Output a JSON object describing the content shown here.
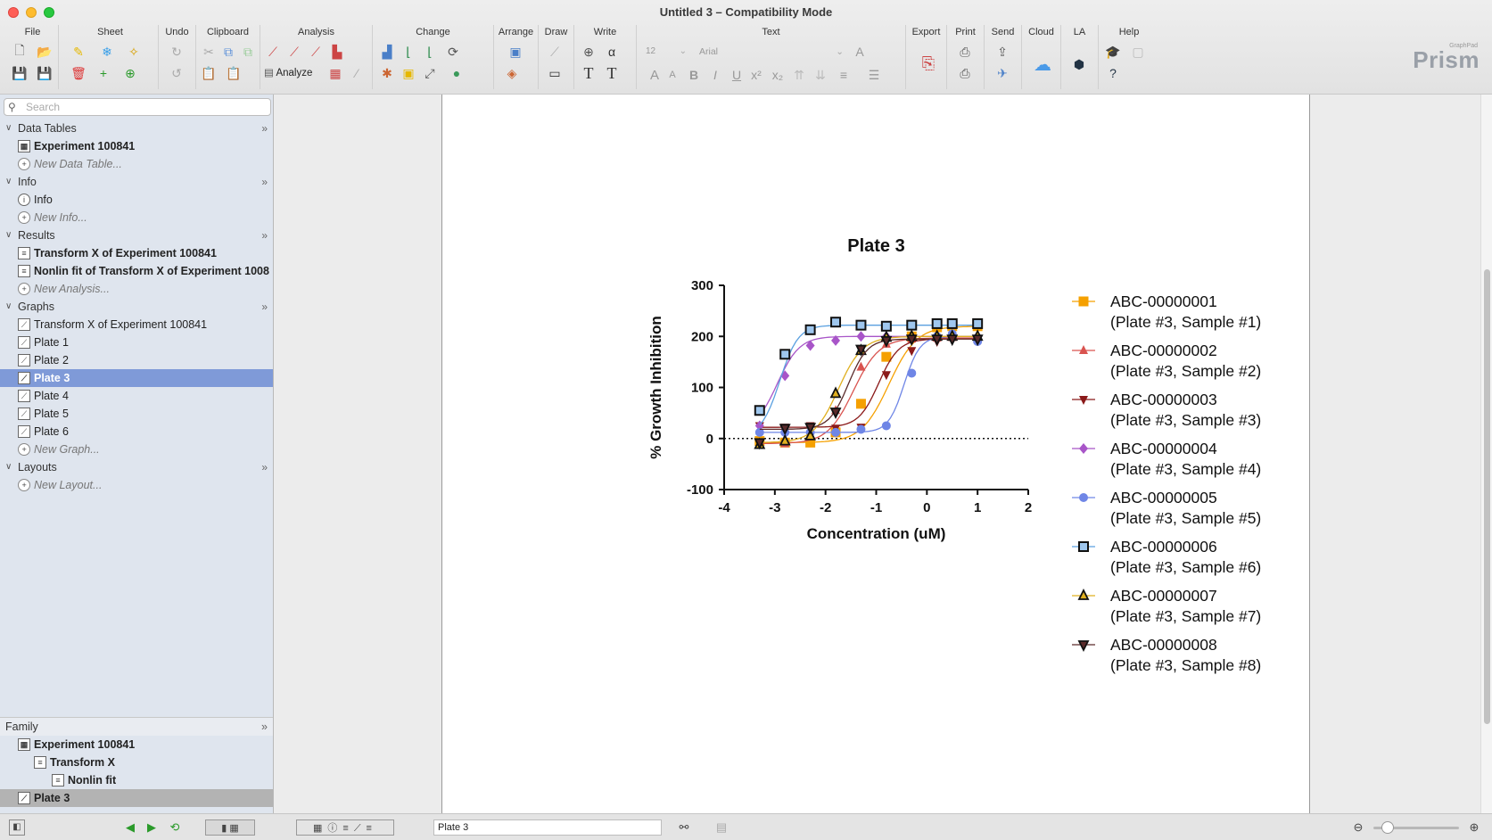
{
  "window": {
    "title": "Untitled 3 – Compatibility Mode"
  },
  "toolbar": {
    "groups": [
      "File",
      "Sheet",
      "Undo",
      "Clipboard",
      "Analysis",
      "Change",
      "Arrange",
      "Draw",
      "Write",
      "Text",
      "Export",
      "Print",
      "Send",
      "Cloud",
      "LA",
      "Help"
    ],
    "analyze_label": "Analyze",
    "font_size": "12",
    "font_name": "Arial",
    "brand_small": "GraphPad",
    "brand": "Prism"
  },
  "sidebar": {
    "search_placeholder": "Search",
    "sections": {
      "data_tables": "Data Tables",
      "info": "Info",
      "results": "Results",
      "graphs": "Graphs",
      "layouts": "Layouts"
    },
    "data_tables": [
      "Experiment 100841",
      "New Data Table..."
    ],
    "info": [
      "Info",
      "New Info..."
    ],
    "results": [
      "Transform X of Experiment 100841",
      "Nonlin fit of Transform X of Experiment 1008",
      "New Analysis..."
    ],
    "graphs": [
      "Transform X of Experiment 100841",
      "Plate 1",
      "Plate 2",
      "Plate 3",
      "Plate 4",
      "Plate 5",
      "Plate 6",
      "New Graph..."
    ],
    "layouts": [
      "New Layout..."
    ],
    "family_label": "Family",
    "family": [
      "Experiment 100841",
      "Transform X",
      "Nonlin fit",
      "Plate 3"
    ]
  },
  "status": {
    "sheet_name": "Plate 3"
  },
  "chart_data": {
    "type": "scatter",
    "title": "Plate 3",
    "xlabel": "Concentration (uM)",
    "ylabel": "% Growth Inhibition",
    "xlim": [
      -4,
      2
    ],
    "ylim": [
      -100,
      300
    ],
    "xticks": [
      -4,
      -3,
      -2,
      -1,
      0,
      1,
      2
    ],
    "yticks": [
      -100,
      0,
      100,
      200,
      300
    ],
    "zero_line": "dotted",
    "legend_position": "right",
    "x": [
      -3.3,
      -2.8,
      -2.3,
      -1.8,
      -1.3,
      -0.8,
      -0.3,
      0.2,
      0.5,
      1.0
    ],
    "series": [
      {
        "name": "ABC-00000001",
        "sub": "(Plate #3, Sample #1)",
        "color": "#f5a000",
        "marker": "square",
        "values": [
          -5,
          -8,
          -8,
          12,
          68,
          160,
          200,
          218,
          220,
          220
        ],
        "fit_ec50": -0.75,
        "top": 220,
        "bottom": -8,
        "hill": 1.6
      },
      {
        "name": "ABC-00000002",
        "sub": "(Plate #3, Sample #2)",
        "color": "#d9534f",
        "marker": "triangle-up",
        "values": [
          -10,
          -10,
          8,
          55,
          140,
          185,
          195,
          197,
          198,
          196
        ],
        "fit_ec50": -1.45,
        "top": 197,
        "bottom": -10,
        "hill": 1.7
      },
      {
        "name": "ABC-00000003",
        "sub": "(Plate #3, Sample #3)",
        "color": "#8b1a1a",
        "marker": "triangle-down",
        "values": [
          25,
          22,
          25,
          20,
          22,
          125,
          172,
          190,
          195,
          195
        ],
        "fit_ec50": -0.95,
        "top": 195,
        "bottom": 22,
        "hill": 2.2
      },
      {
        "name": "ABC-00000004",
        "sub": "(Plate #3, Sample #4)",
        "color": "#a855c8",
        "marker": "diamond",
        "values": [
          25,
          123,
          182,
          192,
          200,
          200,
          200,
          200,
          200,
          200
        ],
        "fit_ec50": -2.95,
        "top": 200,
        "bottom": 15,
        "hill": 2.0
      },
      {
        "name": "ABC-00000005",
        "sub": "(Plate #3, Sample #5)",
        "color": "#6f86e6",
        "marker": "circle",
        "values": [
          12,
          12,
          12,
          12,
          18,
          25,
          128,
          200,
          205,
          190
        ],
        "fit_ec50": -0.45,
        "top": 200,
        "bottom": 12,
        "hill": 2.8
      },
      {
        "name": "ABC-00000006",
        "sub": "(Plate #3, Sample #6)",
        "color": "#5aa0e0",
        "marker": "square-open",
        "values": [
          55,
          165,
          213,
          228,
          222,
          220,
          222,
          225,
          225,
          225
        ],
        "fit_ec50": -2.9,
        "top": 222,
        "bottom": 5,
        "hill": 2.4
      },
      {
        "name": "ABC-00000007",
        "sub": "(Plate #3, Sample #7)",
        "color": "#e0b020",
        "marker": "triangle-up-open",
        "values": [
          -12,
          -5,
          5,
          88,
          172,
          198,
          200,
          200,
          200,
          200
        ],
        "fit_ec50": -1.75,
        "top": 200,
        "bottom": -8,
        "hill": 1.8
      },
      {
        "name": "ABC-00000008",
        "sub": "(Plate #3, Sample #8)",
        "color": "#5a2a2a",
        "marker": "triangle-down-open",
        "values": [
          -8,
          20,
          22,
          52,
          175,
          192,
          195,
          195,
          195,
          195
        ],
        "fit_ec50": -1.55,
        "top": 195,
        "bottom": 18,
        "hill": 2.3
      }
    ]
  }
}
